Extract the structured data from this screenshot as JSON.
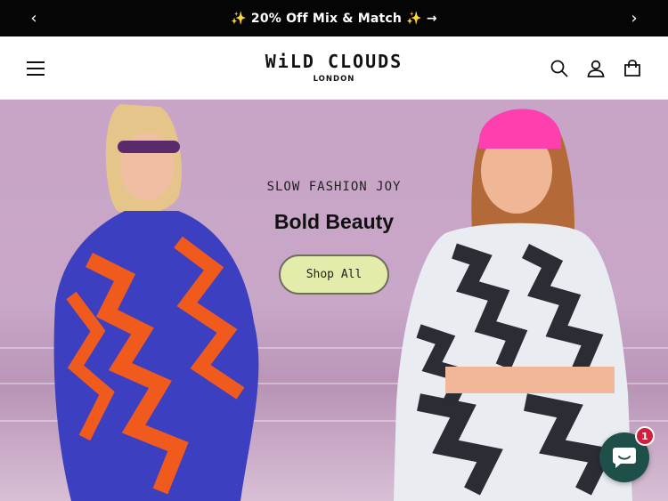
{
  "announcement": {
    "text": "✨ 20% Off Mix & Match ✨ →",
    "prev_label": "‹",
    "next_label": "›"
  },
  "header": {
    "logo_main": "WiLD CLOUDS",
    "logo_sub": "LONDON",
    "icons": [
      "menu-icon",
      "search-icon",
      "account-icon",
      "cart-icon"
    ]
  },
  "hero": {
    "eyebrow": "SLOW FASHION JOY",
    "headline": "Bold Beauty",
    "cta_label": "Shop All"
  },
  "chat": {
    "badge_count": "1",
    "icon": "chat-icon"
  },
  "colors": {
    "announcement_bg": "#050505",
    "hero_bg": "#c9a7c9",
    "cta_bg": "#e3ecaa",
    "chat_bg": "#1e4f48",
    "badge_bg": "#d11f3c"
  }
}
